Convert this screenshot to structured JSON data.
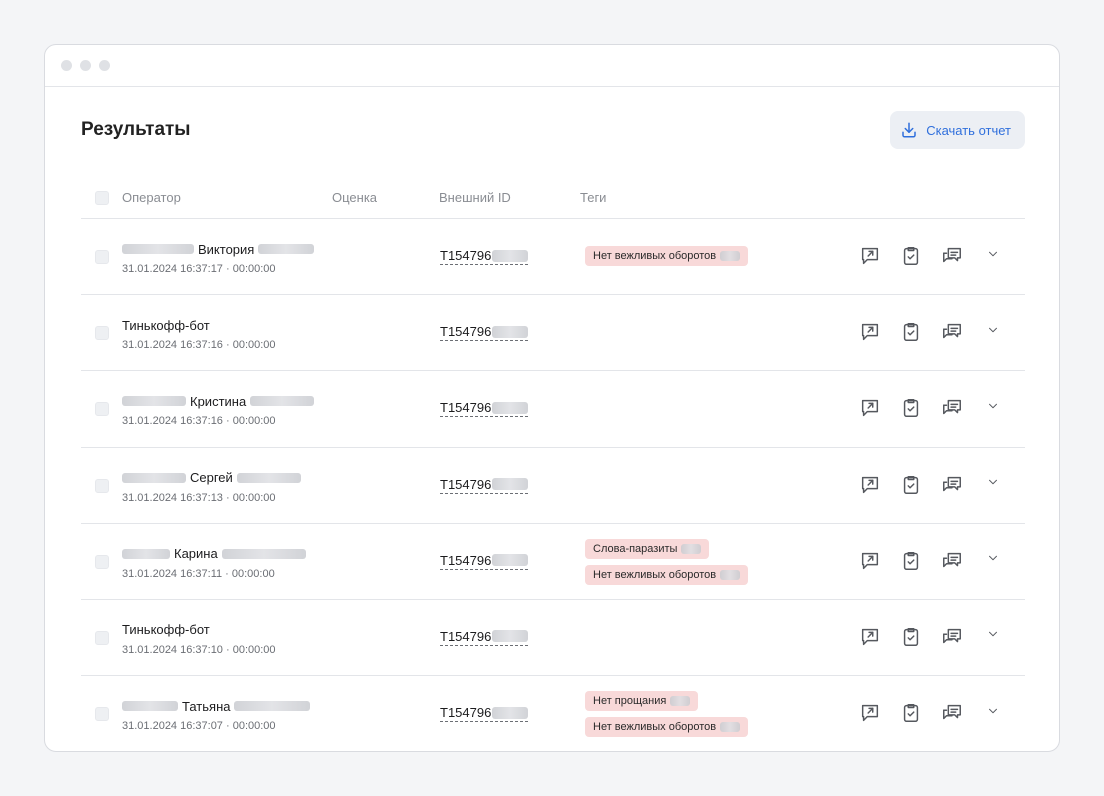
{
  "page": {
    "title": "Результаты",
    "download_label": "Скачать отчет"
  },
  "columns": {
    "operator": "Оператор",
    "rating": "Оценка",
    "external_id": "Внешний ID",
    "tags": "Теги"
  },
  "rows": [
    {
      "pre_blur": 72,
      "name": "Виктория",
      "post_blur": 56,
      "time": "31.01.2024 16:37:17 · 00:00:00",
      "ext_id": "T154796",
      "tags": [
        "Нет вежливых оборотов"
      ]
    },
    {
      "pre_blur": 0,
      "name": "Тинькофф-бот",
      "post_blur": 0,
      "time": "31.01.2024 16:37:16 · 00:00:00",
      "ext_id": "T154796",
      "tags": []
    },
    {
      "pre_blur": 64,
      "name": "Кристина",
      "post_blur": 64,
      "time": "31.01.2024 16:37:16 · 00:00:00",
      "ext_id": "T154796",
      "tags": []
    },
    {
      "pre_blur": 64,
      "name": "Сергей",
      "post_blur": 64,
      "time": "31.01.2024 16:37:13 · 00:00:00",
      "ext_id": "T154796",
      "tags": []
    },
    {
      "pre_blur": 48,
      "name": "Карина",
      "post_blur": 84,
      "time": "31.01.2024 16:37:11 · 00:00:00",
      "ext_id": "T154796",
      "tags": [
        "Слова-паразиты",
        "Нет вежливых оборотов"
      ]
    },
    {
      "pre_blur": 0,
      "name": "Тинькофф-бот",
      "post_blur": 0,
      "time": "31.01.2024 16:37:10 · 00:00:00",
      "ext_id": "T154796",
      "tags": []
    },
    {
      "pre_blur": 56,
      "name": "Татьяна",
      "post_blur": 76,
      "time": "31.01.2024 16:37:07 · 00:00:00",
      "ext_id": "T154796",
      "tags": [
        "Нет прощания",
        "Нет вежливых оборотов"
      ]
    }
  ],
  "icons": {
    "download": "download-icon",
    "open": "open-chat-icon",
    "checklist": "clipboard-check-icon",
    "comments": "comments-icon",
    "expand": "chevron-down-icon"
  }
}
